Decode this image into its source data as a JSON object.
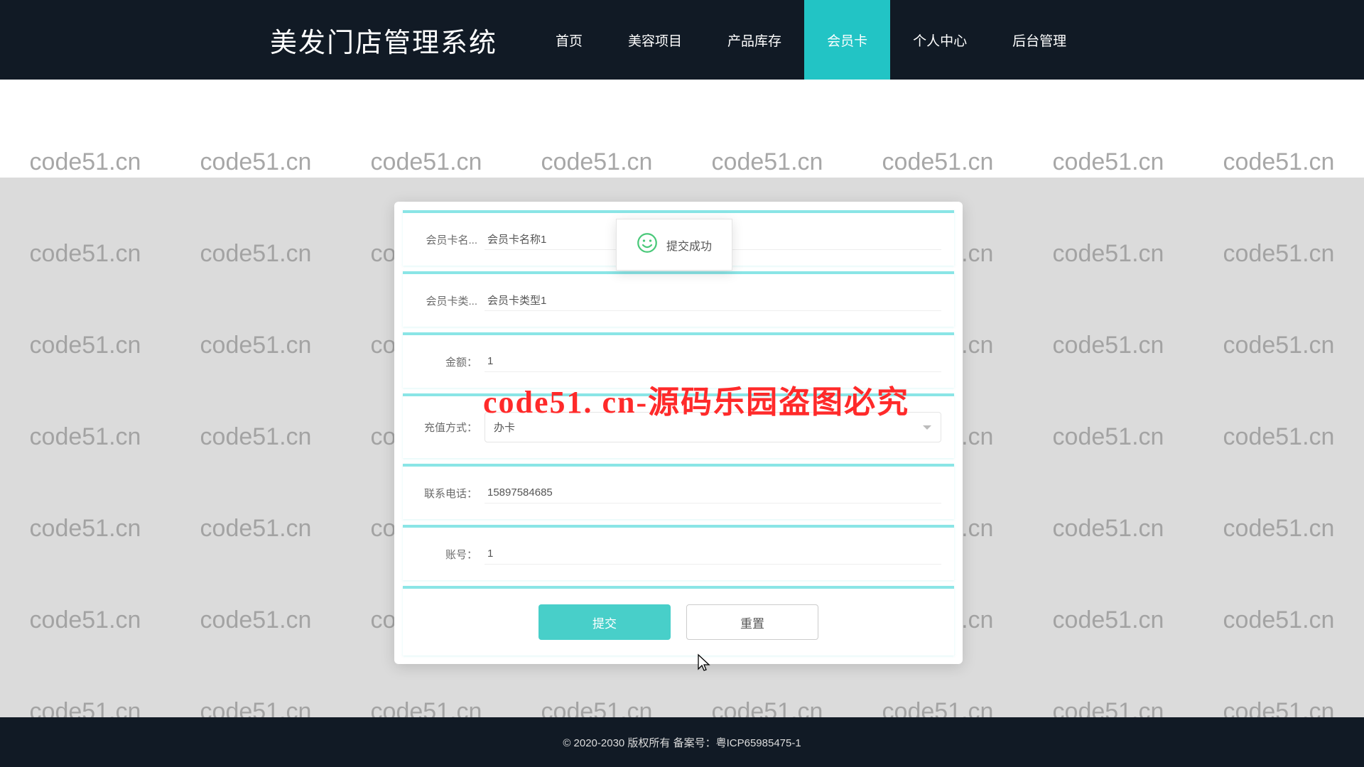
{
  "header": {
    "logo": "美发门店管理系统",
    "nav": [
      {
        "label": "首页",
        "active": false
      },
      {
        "label": "美容项目",
        "active": false
      },
      {
        "label": "产品库存",
        "active": false
      },
      {
        "label": "会员卡",
        "active": true
      },
      {
        "label": "个人中心",
        "active": false
      },
      {
        "label": "后台管理",
        "active": false
      }
    ]
  },
  "form": {
    "fields": {
      "cardName": {
        "label": "会员卡名...",
        "value": "会员卡名称1"
      },
      "cardType": {
        "label": "会员卡类...",
        "value": "会员卡类型1"
      },
      "amount": {
        "label": "金额：",
        "value": "1"
      },
      "rechargeMethod": {
        "label": "充值方式：",
        "value": "办卡"
      },
      "phone": {
        "label": "联系电话：",
        "value": "15897584685"
      },
      "account": {
        "label": "账号：",
        "value": "1"
      }
    },
    "actions": {
      "submit": "提交",
      "reset": "重置"
    }
  },
  "toast": {
    "text": "提交成功"
  },
  "watermark_text": "code51.cn",
  "center_watermark": "code51. cn-源码乐园盗图必究",
  "footer": "© 2020-2030 版权所有 备案号：粤ICP65985475-1"
}
